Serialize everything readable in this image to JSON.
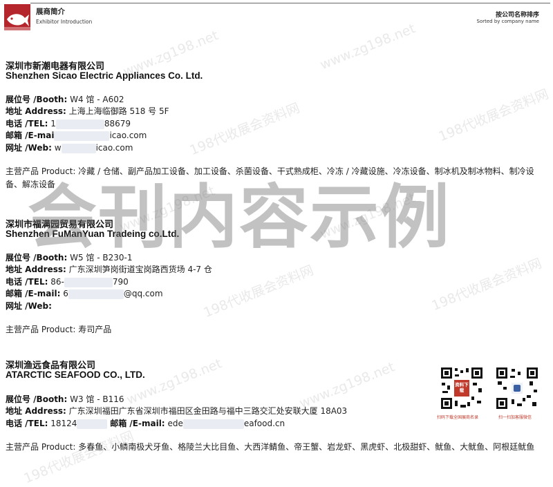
{
  "header": {
    "title_cn": "展商简介",
    "title_en": "Exhibitor Introduction",
    "sort_cn": "按公司名称排序",
    "sort_en": "Sorted by company name"
  },
  "colors": {
    "brand_red": "#b5262c",
    "text": "#1a1a1a",
    "watermark": "#8a8a8a"
  },
  "watermark": {
    "big": "会刊内容示例",
    "url": "www.zg198.net",
    "cn": "198代收展会资料网"
  },
  "companies": [
    {
      "name_cn": "深圳市新潮电器有限公司",
      "name_en": "Shenzhen Sicao Electric Appliances Co. Ltd.",
      "booth_label": "展位号 /Booth:",
      "booth": "W4 馆 - A602",
      "address_label": "地址 Address:",
      "address": "上海上海临御路 518 号 5F",
      "tel_label": "电话 /TEL:",
      "tel_pre": "1",
      "tel_post": "88679",
      "email_label": "邮箱 /E-mai",
      "email_post": "icao.com",
      "web_label": "网址 /Web:",
      "web": "w",
      "web_post": "icao.com",
      "products_label": "主营产品 Product:",
      "products": "冷藏 / 仓储、副产品加工设备、加工设备、杀菌设备、干式熟成柜、冷冻 / 冷藏设施、冷冻设备、制冰机及制冰物料、制冷设备、解冻设备"
    },
    {
      "name_cn": "深圳市福满园贸易有限公司",
      "name_en": "Shenzhen FuManYuan Tradeing co.Ltd.",
      "booth_label": "展位号 /Booth:",
      "booth": "W5 馆 - B230-1",
      "address_label": "地址 Address:",
      "address": "广东深圳笋岗街道宝岗路西货场 4-7 仓",
      "tel_label": "电话 /TEL:",
      "tel_pre": "86-",
      "tel_post": "790",
      "email_label": "邮箱 /E-mail:",
      "email_pre": "6",
      "email_post": "@qq.com",
      "web_label": "网址 /Web:",
      "products_label": "主营产品 Product:",
      "products": "寿司产品"
    },
    {
      "name_cn": "深圳渔远食品有限公司",
      "name_en": "ATARCTIC SEAFOOD CO., LTD.",
      "booth_label": "展位号 /Booth:",
      "booth": "W3 馆 - B116",
      "address_label": "地址 Address:",
      "address": "广东深圳福田广东省深圳市福田区金田路与福中三路交汇处安联大厦 18A03",
      "tel_label": "电话 /TEL:",
      "tel_pre": "18124",
      "email_label": "邮箱 /E-mail:",
      "email_pre": "ede",
      "email_post": "eafood.cn",
      "products_label": "主营产品 Product:",
      "products": "多春鱼、小鳞南极犬牙鱼、格陵兰大比目鱼、大西洋鲭鱼、帝王蟹、岩龙虾、黑虎虾、北极甜虾、鱿鱼、大鱿鱼、阿根廷鱿鱼"
    }
  ],
  "qr": {
    "left_badge": "资料下载",
    "left_caption": "扫码下载全国展商名录",
    "right_caption": "扫一扫加客服微信"
  }
}
